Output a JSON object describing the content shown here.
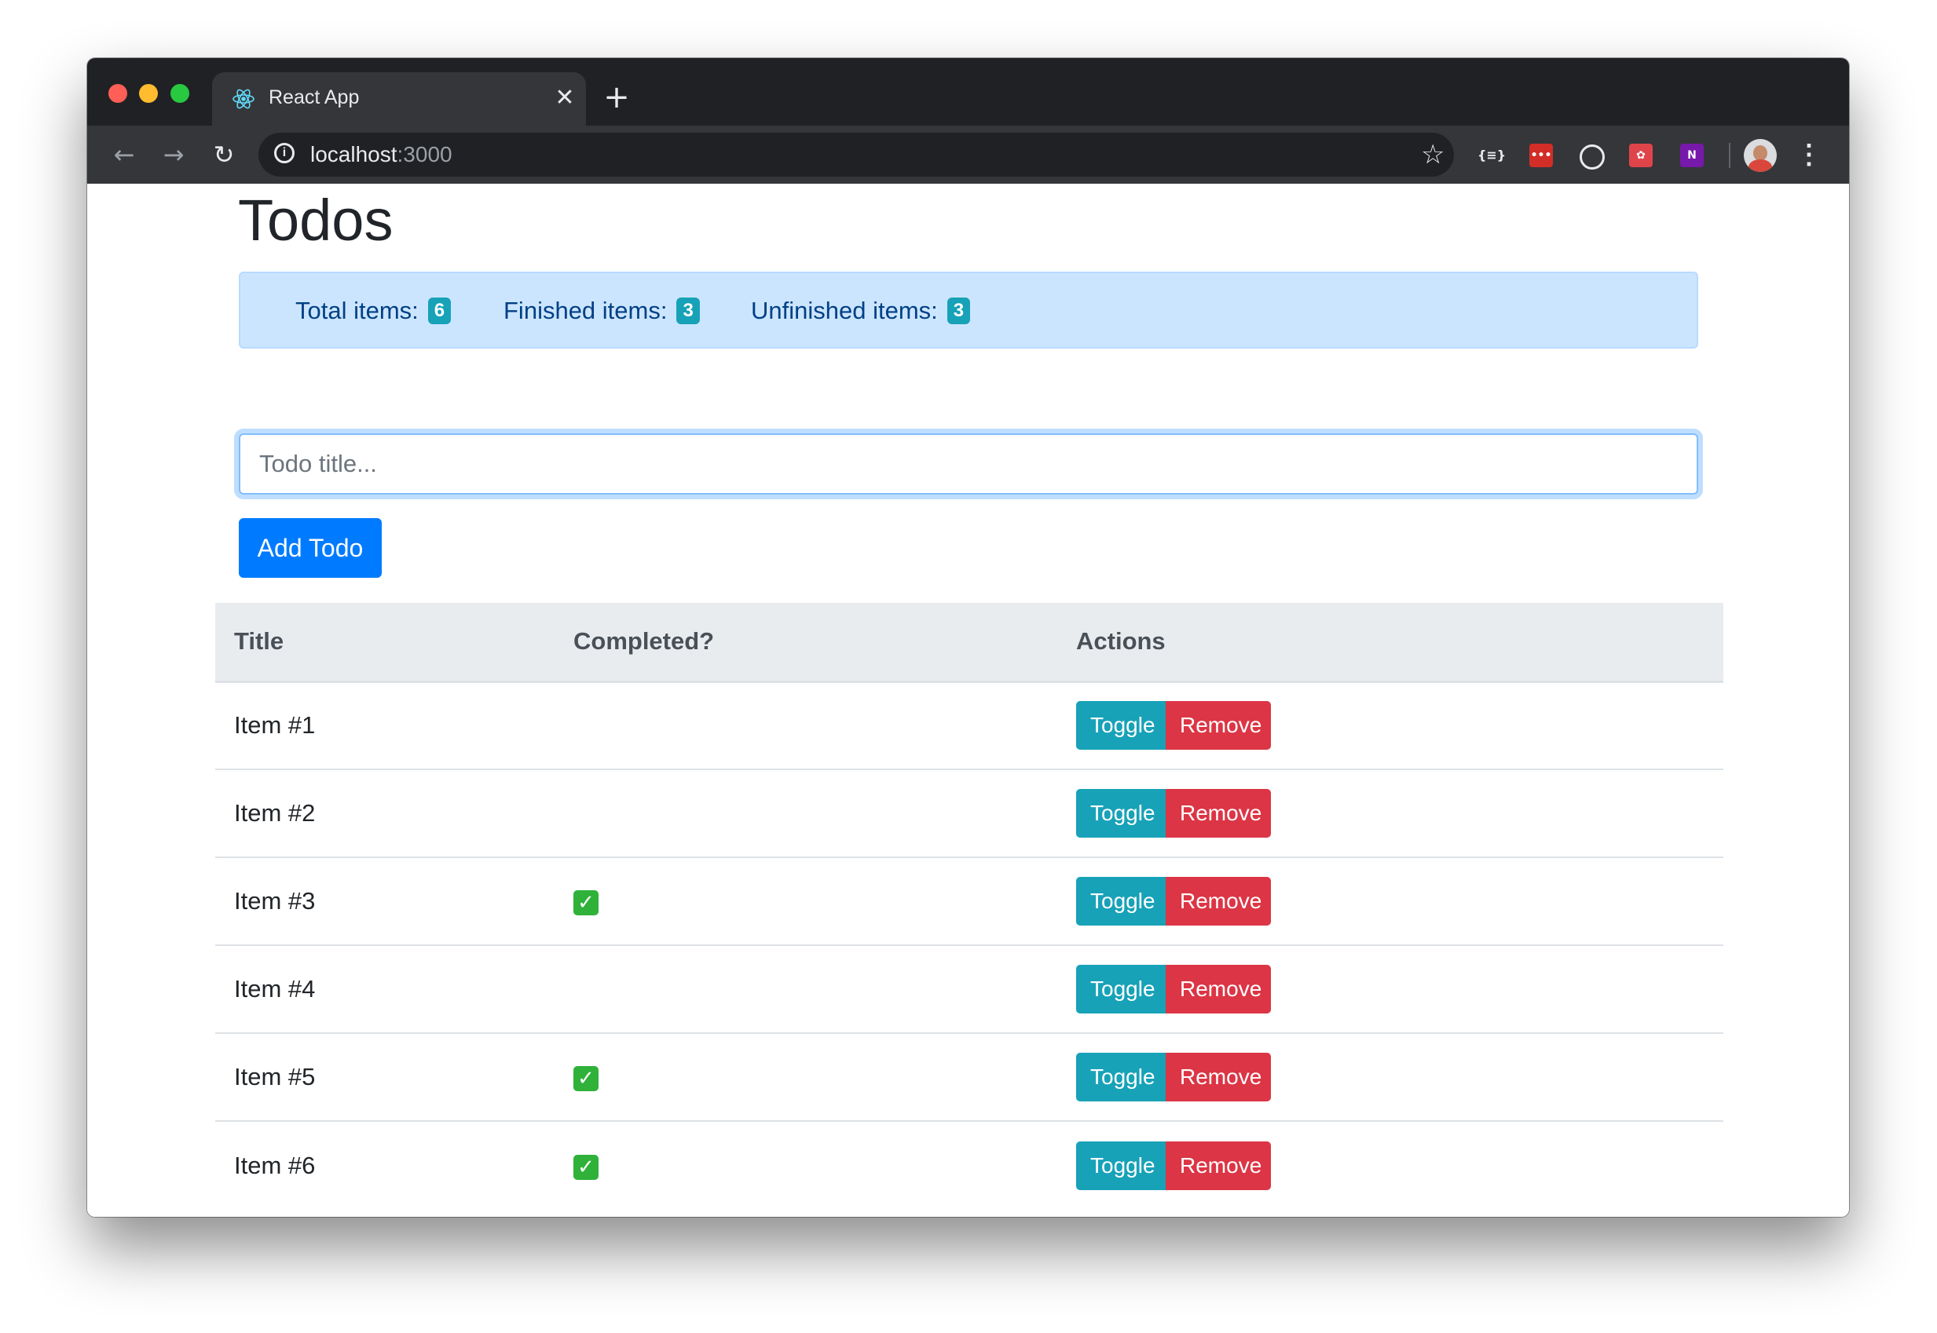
{
  "browser": {
    "tab_title": "React App",
    "tab_icon": "react-icon",
    "url_host": "localhost",
    "url_port": ":3000"
  },
  "page": {
    "title": "Todos",
    "stats": {
      "total_label": "Total items:",
      "total_value": "6",
      "finished_label": "Finished items:",
      "finished_value": "3",
      "unfinished_label": "Unfinished items:",
      "unfinished_value": "3"
    },
    "input_placeholder": "Todo title...",
    "add_button": "Add Todo"
  },
  "table": {
    "headers": [
      "Title",
      "Completed?",
      "Actions"
    ],
    "rows": [
      {
        "title": "Item #1",
        "completed": false,
        "toggle": "Toggle",
        "remove": "Remove"
      },
      {
        "title": "Item #2",
        "completed": false,
        "toggle": "Toggle",
        "remove": "Remove"
      },
      {
        "title": "Item #3",
        "completed": true,
        "toggle": "Toggle",
        "remove": "Remove"
      },
      {
        "title": "Item #4",
        "completed": false,
        "toggle": "Toggle",
        "remove": "Remove"
      },
      {
        "title": "Item #5",
        "completed": true,
        "toggle": "Toggle",
        "remove": "Remove"
      },
      {
        "title": "Item #6",
        "completed": true,
        "toggle": "Toggle",
        "remove": "Remove"
      }
    ]
  },
  "colors": {
    "primary": "#007bff",
    "info": "#17a2b8",
    "danger": "#dc3545",
    "alert_bg": "#cce5ff",
    "check_green": "#2fb13a"
  }
}
